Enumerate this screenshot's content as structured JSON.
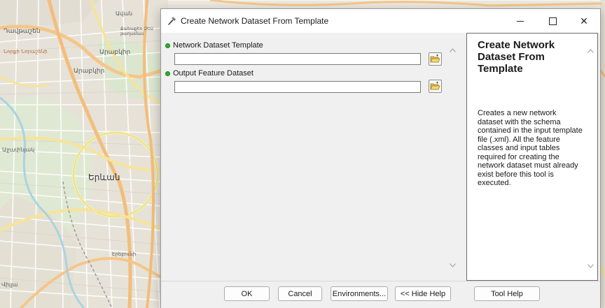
{
  "map": {
    "labels": [
      "Դավթաշեն",
      "Քանաքեռ ԶԵՍ թաղամաս",
      "Ավան",
      "Նորքի Նորաշենի",
      "Արաբկիր",
      "Արաբկիր",
      "Աջափնյակ",
      "Երևան",
      "Էրեբունի",
      "Վիլլա"
    ]
  },
  "window": {
    "title": "Create Network Dataset From Template",
    "controls": {
      "minimize": "minimize",
      "maximize": "maximize",
      "close": "✕"
    }
  },
  "params": [
    {
      "label": "Network Dataset Template",
      "value": "",
      "required": true
    },
    {
      "label": "Output Feature Dataset",
      "value": "",
      "required": true
    }
  ],
  "help": {
    "title": "Create Network Dataset From Template",
    "body": "Creates a new network dataset with the schema contained in the input template file (.xml). All the feature classes and input tables required for creating the network dataset must already exist before this tool is executed."
  },
  "buttons": {
    "ok": "OK",
    "cancel": "Cancel",
    "environments": "Environments...",
    "hide_help": "<< Hide Help",
    "tool_help": "Tool Help"
  },
  "colors": {
    "required_indicator": "#2fae2f",
    "folder_icon": "#e7c65a"
  }
}
